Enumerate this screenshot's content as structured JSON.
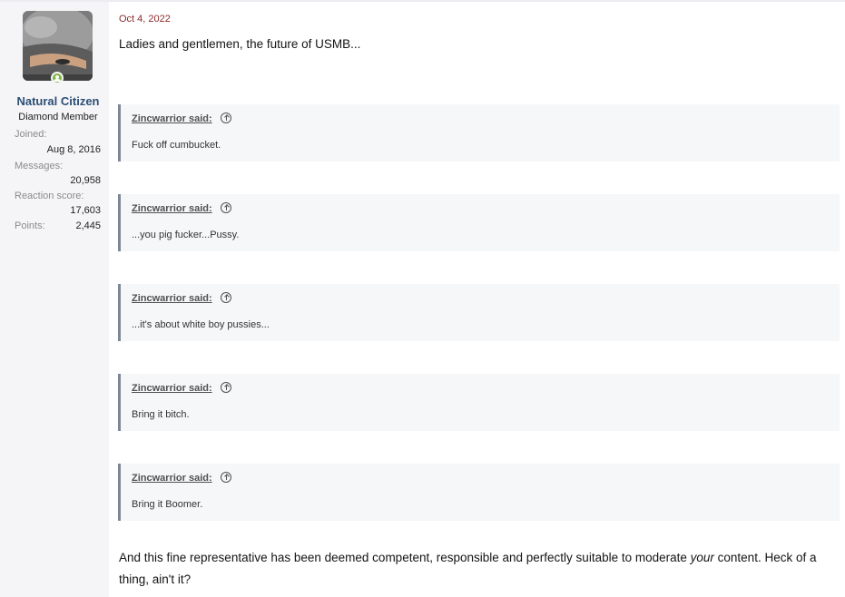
{
  "user": {
    "name": "Natural Citizen",
    "title": "Diamond Member",
    "stats": {
      "joined_label": "Joined:",
      "joined_value": "Aug 8, 2016",
      "messages_label": "Messages:",
      "messages_value": "20,958",
      "reaction_label": "Reaction score:",
      "reaction_value": "17,603",
      "points_label": "Points:",
      "points_value": "2,445"
    }
  },
  "post": {
    "date": "Oct 4, 2022",
    "intro": "Ladies and gentlemen, the future of USMB...",
    "quotes": [
      {
        "author": "Zincwarrior said:",
        "text": "Fuck off cumbucket."
      },
      {
        "author": "Zincwarrior said:",
        "text": "...you pig fucker...Pussy."
      },
      {
        "author": "Zincwarrior said:",
        "text": "...it's about white boy pussies..."
      },
      {
        "author": "Zincwarrior said:",
        "text": "Bring it bitch."
      },
      {
        "author": "Zincwarrior said:",
        "text": "Bring it Boomer."
      }
    ],
    "outro_part1": "And this fine representative has been deemed competent, responsible and perfectly suitable to moderate ",
    "outro_emphasis": "your",
    "outro_part2": " content. Heck of a thing, ain't it?"
  },
  "icons": {
    "online": "online-status-icon",
    "quote_jump": "circle-arrow-up-icon"
  },
  "colors": {
    "username": "#2c4e76",
    "date": "#8c2b2b",
    "online": "#7fb53f",
    "quote_border": "#7d8796",
    "quote_bg": "#f6f7f9"
  }
}
